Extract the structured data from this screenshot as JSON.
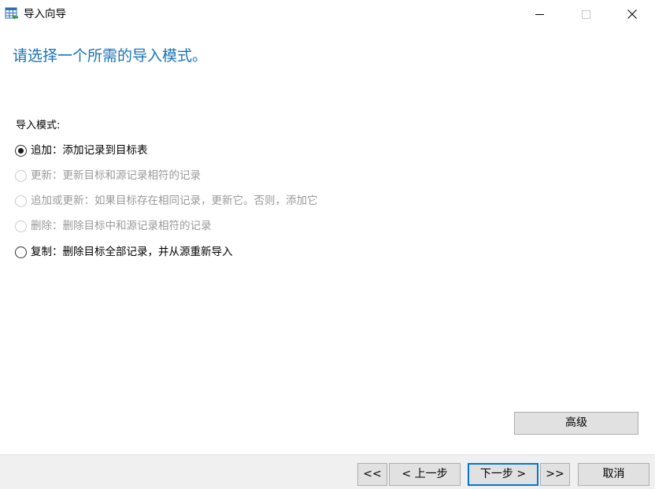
{
  "window": {
    "title": "导入向导",
    "icon": "table-import-icon"
  },
  "heading": "请选择一个所需的导入模式。",
  "mode_group": {
    "label": "导入模式:",
    "options": [
      {
        "label": "追加：添加记录到目标表",
        "checked": true,
        "enabled": true
      },
      {
        "label": "更新：更新目标和源记录相符的记录",
        "checked": false,
        "enabled": false
      },
      {
        "label": "追加或更新：如果目标存在相同记录，更新它。否则，添加它",
        "checked": false,
        "enabled": false
      },
      {
        "label": "删除：删除目标中和源记录相符的记录",
        "checked": false,
        "enabled": false
      },
      {
        "label": "复制：删除目标全部记录，并从源重新导入",
        "checked": false,
        "enabled": true
      }
    ]
  },
  "advanced_label": "高级",
  "footer": {
    "first_label": "<<",
    "prev_label": "< 上一步",
    "next_label": "下一步 >",
    "last_label": ">>",
    "cancel_label": "取消"
  },
  "colors": {
    "heading": "#1a73b8",
    "button_bg": "#e1e1e1",
    "focus_border": "#0078d7",
    "disabled_text": "#9a9a9a"
  }
}
